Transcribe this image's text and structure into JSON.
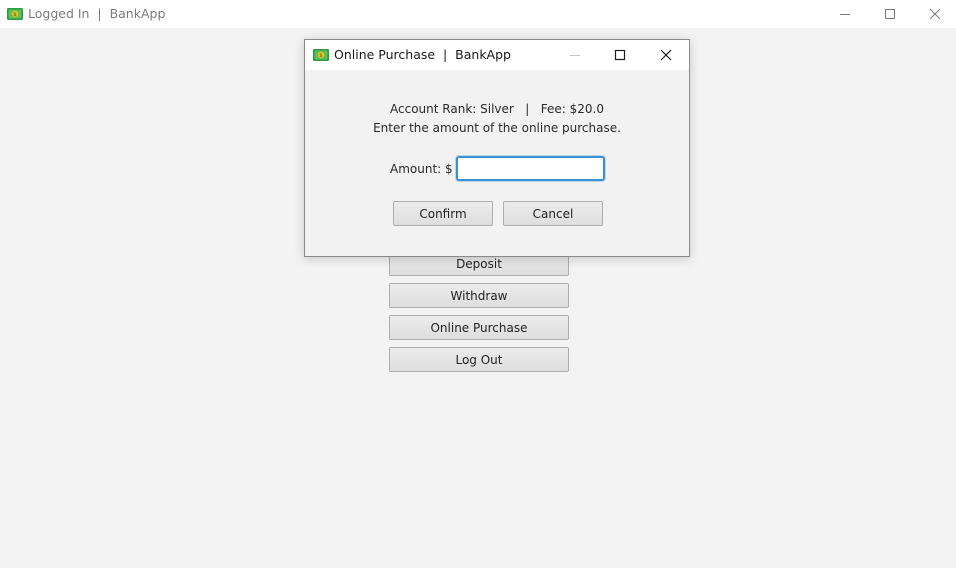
{
  "main_window": {
    "title": "Logged In  |  BankApp",
    "icon": "bankapp-money-icon",
    "controls": [
      "minimize-icon",
      "maximize-icon",
      "close-icon"
    ],
    "buttons": {
      "deposit": "Deposit",
      "withdraw": "Withdraw",
      "online_purchase": "Online Purchase",
      "log_out": "Log Out"
    }
  },
  "dialog": {
    "title": "Online Purchase  |  BankApp",
    "icon": "bankapp-money-icon",
    "account_info": "Account Rank: Silver   |   Fee: $20.0",
    "instruction": "Enter the amount of the online purchase.",
    "amount_label": "Amount: $",
    "amount_value": "",
    "confirm_label": "Confirm",
    "cancel_label": "Cancel"
  },
  "colors": {
    "background": "#f3f3f3",
    "titlebar": "#ffffff",
    "focus_border": "#3d8fd1",
    "icon_green": "#2e9c3a",
    "icon_yellow": "#f2c21b"
  }
}
